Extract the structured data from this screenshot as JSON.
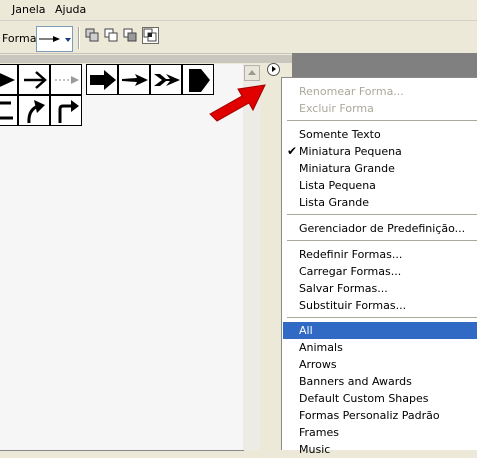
{
  "menubar": {
    "items": [
      {
        "label": "Janela"
      },
      {
        "label": "Ajuda"
      }
    ]
  },
  "options_bar": {
    "shape_label": "Forma:",
    "current_shape_icon": "thin-arrow-right-icon",
    "dropdown_icon": "chevron-down-icon",
    "mode_icons": [
      "new-layer-icon",
      "add-to-shape-icon",
      "subtract-shape-icon",
      "intersect-shape-icon"
    ],
    "active_mode_index": 3
  },
  "shapes_panel": {
    "row1": [
      "filled-arrow-right-icon",
      "arrow-right-icon",
      "thin-dashed-arrow-icon",
      "bold-arrow-right-icon",
      "slim-arrow-right-icon",
      "double-chevron-arrow-icon",
      "block-arrow-icon"
    ],
    "row2": [
      "u-turn-arrow-icon",
      "curved-arrow-icon",
      "bent-arrow-icon"
    ],
    "flyout_icon": "flyout-menu-icon",
    "callout_icon": "red-arrow-icon",
    "callout_color": "#e00000"
  },
  "context_menu": {
    "selection_color": "#316ac5",
    "groups": [
      {
        "items": [
          {
            "label": "Renomear Forma...",
            "disabled": true
          },
          {
            "label": "Excluir Forma",
            "disabled": true
          }
        ]
      },
      {
        "items": [
          {
            "label": "Somente Texto"
          },
          {
            "label": "Miniatura Pequena",
            "checked": true
          },
          {
            "label": "Miniatura Grande"
          },
          {
            "label": "Lista Pequena"
          },
          {
            "label": "Lista Grande"
          }
        ]
      },
      {
        "items": [
          {
            "label": "Gerenciador de Predefinição..."
          }
        ]
      },
      {
        "items": [
          {
            "label": "Redefinir Formas..."
          },
          {
            "label": "Carregar Formas..."
          },
          {
            "label": "Salvar Formas..."
          },
          {
            "label": "Substituir Formas..."
          }
        ]
      },
      {
        "items": [
          {
            "label": "All",
            "selected": true
          },
          {
            "label": "Animals"
          },
          {
            "label": "Arrows"
          },
          {
            "label": "Banners and Awards"
          },
          {
            "label": "Default Custom Shapes"
          },
          {
            "label": "Formas Personaliz Padrão"
          },
          {
            "label": "Frames"
          },
          {
            "label": "Music"
          }
        ]
      }
    ]
  }
}
